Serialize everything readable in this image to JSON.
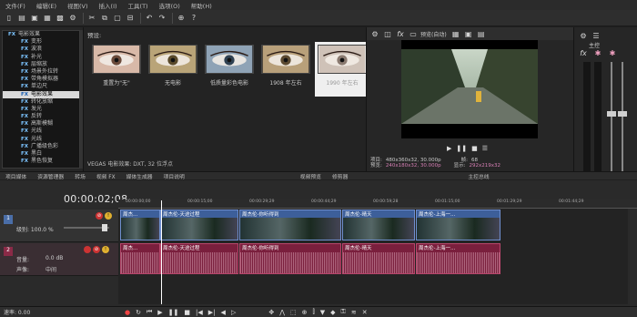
{
  "menu": [
    "文件(F)",
    "编辑(E)",
    "视图(V)",
    "插入(I)",
    "工具(T)",
    "选项(O)",
    "帮助(H)"
  ],
  "toolbar": {
    "icons": [
      "new-icon",
      "open-icon",
      "save-icon",
      "save-as-icon",
      "render-icon",
      "properties-icon",
      "cut-icon",
      "copy-icon",
      "paste-icon",
      "trim-icon",
      "undo-icon",
      "redo-icon",
      "snap-icon",
      "help-icon"
    ]
  },
  "tree": {
    "items": [
      {
        "label": "电影效果",
        "top": false,
        "selected": false
      },
      {
        "label": "变形",
        "top": false,
        "selected": false
      },
      {
        "label": "波浪",
        "top": false,
        "selected": false
      },
      {
        "label": "补光",
        "top": false,
        "selected": false
      },
      {
        "label": "层缩放",
        "top": false,
        "selected": false
      },
      {
        "label": "场景外拉转",
        "top": false,
        "selected": false
      },
      {
        "label": "带角模拟器",
        "top": false,
        "selected": false
      },
      {
        "label": "单边尺",
        "top": false,
        "selected": false
      },
      {
        "label": "电影效果",
        "top": false,
        "selected": true
      },
      {
        "label": "转化放缩",
        "top": false,
        "selected": false
      },
      {
        "label": "发光",
        "top": false,
        "selected": false
      },
      {
        "label": "反转",
        "top": false,
        "selected": false
      },
      {
        "label": "高斯模糊",
        "top": false,
        "selected": false
      },
      {
        "label": "光线",
        "top": false,
        "selected": false
      },
      {
        "label": "光线",
        "top": false,
        "selected": false
      },
      {
        "label": "广播级色彩",
        "top": false,
        "selected": false
      },
      {
        "label": "黑白",
        "top": false,
        "selected": false
      },
      {
        "label": "黑色恢复",
        "top": false,
        "selected": false
      }
    ]
  },
  "presets": {
    "label": "预设:",
    "tiles": [
      {
        "label": "重置为\"无\"",
        "selected": false,
        "tint": "natural"
      },
      {
        "label": "无电影",
        "selected": false,
        "tint": "warm"
      },
      {
        "label": "低质量彩色电影",
        "selected": false,
        "tint": "cool"
      },
      {
        "label": "1908 年左右",
        "selected": false,
        "tint": "sepia"
      },
      {
        "label": "1990 年左右",
        "selected": true,
        "tint": "faded"
      }
    ],
    "status": "VEGAS 电影效果: DXT, 32 位浮点"
  },
  "preview": {
    "toolbar_label": "预览(自动)",
    "info": {
      "project_label": "项目:",
      "project_val": "480x360x32, 30.000p",
      "preview_label": "预览:",
      "preview_val": "240x180x32, 30.000p",
      "frame_label": "帧:",
      "frame_val": "68",
      "display_label": "显示:",
      "display_val": "292x219x32"
    }
  },
  "master": {
    "label": "主控"
  },
  "tabs": [
    "项目媒体",
    "资源管理器",
    "转场",
    "视频 FX",
    "媒体生成器",
    "项目说明",
    "视频预览",
    "修剪器",
    "主控总线"
  ],
  "timeline": {
    "timecode": "00:00:02;08",
    "ruler": [
      "00:00:00;00",
      "00:00:15;00",
      "00:00:29;29",
      "00:00:44;29",
      "00:00:59;28",
      "00:01:15;00",
      "00:01:29;29",
      "00:01:44;29"
    ],
    "tracks": {
      "video": {
        "num": "1",
        "level_label": "级别: 100.0 %"
      },
      "audio": {
        "num": "2",
        "vol_label": "音量:",
        "vol_val": "0.0 dB",
        "pan_label": "声像:",
        "pan_val": "中间"
      }
    },
    "video_clips": [
      "周杰...",
      "周杰伦-天途过程",
      "周杰伦-你听得到",
      "周杰伦-晴天",
      "周杰伦-上海一..."
    ],
    "audio_clips": [
      "周杰...",
      "周杰伦-天途过程",
      "周杰伦-你听得到",
      "周杰伦-晴天",
      "周杰伦-上海一..."
    ]
  },
  "transport": {
    "rate": "速率: 0.00"
  }
}
